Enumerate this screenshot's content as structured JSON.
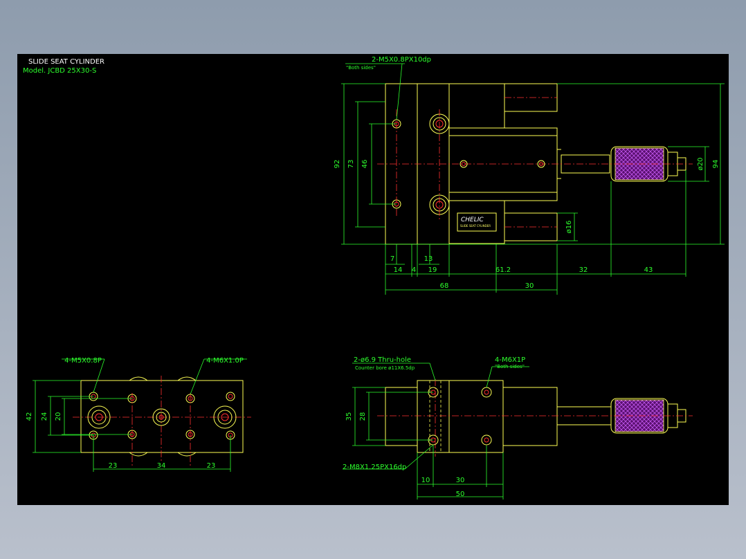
{
  "title": "SLIDE SEAT CYLINDER",
  "model": "Model. JCBD 25X30-S",
  "brand": "CHELIC",
  "top_view": {
    "callout_thread": "2-M5X0.8PX10dp",
    "callout_sides": "\"Both sides\"",
    "dim_vertical": [
      "92",
      "73",
      "46"
    ],
    "dim_right": [
      "ø20",
      "94",
      "ø16"
    ],
    "dim_bottom_row1": [
      "7",
      "13"
    ],
    "dim_bottom_row2": [
      "14",
      "4",
      "19",
      "61.2",
      "32",
      "43"
    ],
    "dim_bottom_row3": [
      "68",
      "30"
    ]
  },
  "bottom_left_view": {
    "callout_left": "4-M5X0.8P",
    "callout_right": "4-M6X1.0P",
    "dim_vertical": [
      "42",
      "24",
      "20"
    ],
    "dim_bottom": [
      "23",
      "34",
      "23"
    ]
  },
  "bottom_right_view": {
    "callout_thru": "2-ø6.9 Thru-hole",
    "callout_counter": "Counter bore ø11X6.5dp",
    "callout_thread": "4-M6X1P",
    "callout_sides": "\"Both sides\"",
    "callout_bottom": "2-M8X1.25PX16dp",
    "dim_vertical": [
      "35",
      "28"
    ],
    "dim_bottom": [
      "10",
      "30",
      "50"
    ]
  },
  "colors": {
    "background": "#000000",
    "outline": "#ffff55",
    "dimension": "#2dff2d",
    "centerline": "#ff3030",
    "hatch": "#b040d0"
  }
}
